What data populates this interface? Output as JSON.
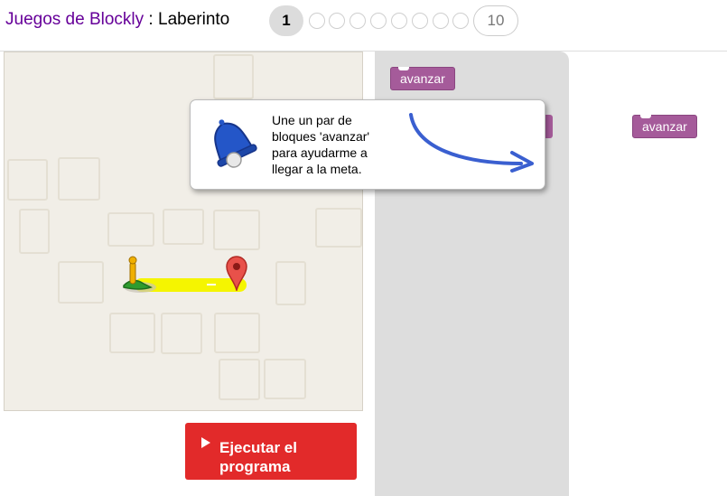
{
  "header": {
    "app_title": "Juegos de Blockly",
    "separator": " : ",
    "page_title": "Laberinto",
    "current_level": "1",
    "last_level": "10",
    "level_dots": 8
  },
  "run_button": {
    "label_line1": "Ejecutar el",
    "label_line2": "programa"
  },
  "toolbox": {
    "block_label": "avanzar"
  },
  "workspace": {
    "block_label": "avanzar"
  },
  "hint": {
    "text": "Une un par de bloques 'avanzar' para ayudarme a llegar a la meta."
  },
  "colors": {
    "title_purple": "#660099",
    "block_purple": "#a55b9a",
    "run_red": "#e22a2a",
    "path_yellow": "#f5f500",
    "bell_blue": "#2456c8",
    "arrow_blue": "#3a5fd0"
  },
  "icons": [
    "bell-icon",
    "pegman-icon",
    "goal-marker-icon",
    "play-icon",
    "arrow-icon"
  ]
}
